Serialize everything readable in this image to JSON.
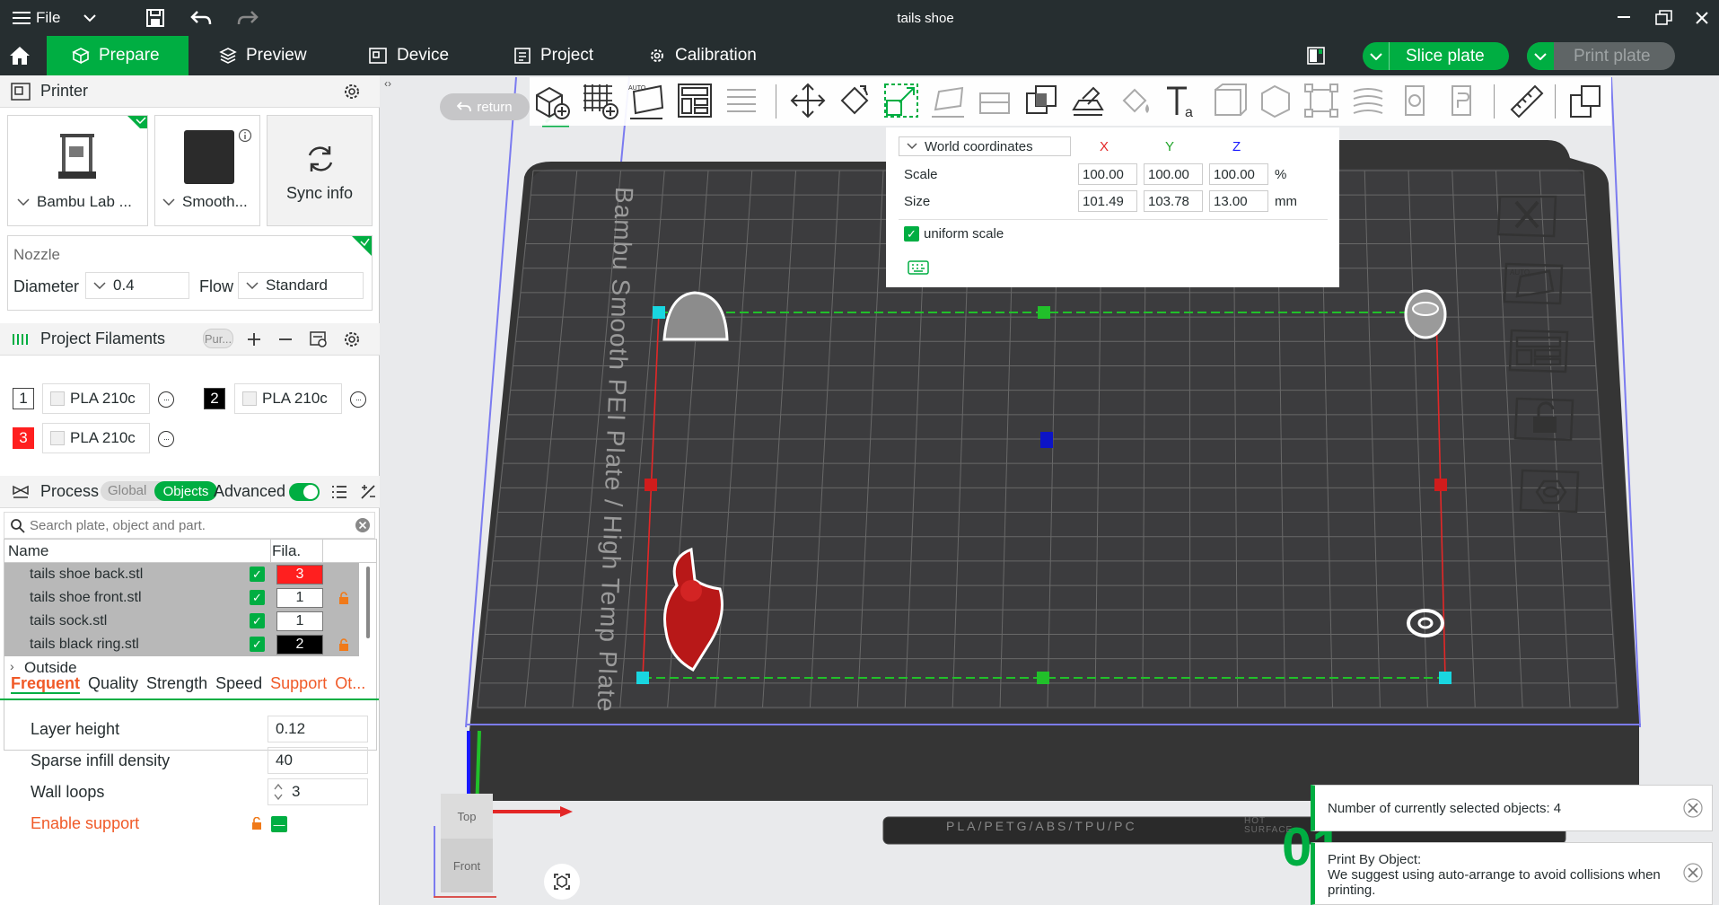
{
  "window": {
    "title": "tails shoe",
    "file_menu": "File"
  },
  "nav": {
    "tabs": [
      {
        "label": "Prepare"
      },
      {
        "label": "Preview"
      },
      {
        "label": "Device"
      },
      {
        "label": "Project"
      },
      {
        "label": "Calibration"
      }
    ],
    "slice_button": "Slice plate",
    "print_button": "Print plate"
  },
  "printer": {
    "header": "Printer",
    "printer_name": "Bambu Lab ...",
    "plate_name": "Smooth...",
    "sync_label": "Sync info",
    "nozzle_header": "Nozzle",
    "diameter_label": "Diameter",
    "diameter_value": "0.4",
    "flow_label": "Flow",
    "flow_value": "Standard"
  },
  "filaments": {
    "header": "Project Filaments",
    "purge_label": "Pur...",
    "items": [
      {
        "num": "1",
        "name": "PLA 210c",
        "color": "#ffffff"
      },
      {
        "num": "2",
        "name": "PLA 210c",
        "color": "#000000"
      },
      {
        "num": "3",
        "name": "PLA 210c",
        "color": "#ff1f1f"
      }
    ]
  },
  "process": {
    "header": "Process",
    "global_label": "Global",
    "objects_label": "Objects",
    "advanced_label": "Advanced",
    "search_placeholder": "Search plate, object and part.",
    "col_name": "Name",
    "col_fila": "Fila.",
    "objects": [
      {
        "name": "tails shoe back.stl",
        "fila": "3",
        "fila_bg": "#ff1f1f",
        "fila_fg": "#ffffff",
        "locked": false
      },
      {
        "name": "tails shoe front.stl",
        "fila": "1",
        "fila_bg": "#ffffff",
        "fila_fg": "#000000",
        "locked": true
      },
      {
        "name": "tails sock.stl",
        "fila": "1",
        "fila_bg": "#ffffff",
        "fila_fg": "#000000",
        "locked": false
      },
      {
        "name": "tails black ring.stl",
        "fila": "2",
        "fila_bg": "#000000",
        "fila_fg": "#ffffff",
        "locked": true
      }
    ],
    "outside_label": "Outside",
    "tabs": [
      "Frequent",
      "Quality",
      "Strength",
      "Speed",
      "Support",
      "Ot..."
    ],
    "layer_height_label": "Layer height",
    "layer_height_value": "0.12",
    "sparse_infill_label": "Sparse infill density",
    "sparse_infill_value": "40",
    "wall_loops_label": "Wall loops",
    "wall_loops_value": "3",
    "enable_support_label": "Enable support"
  },
  "viewport": {
    "return_label": "return",
    "plate_label": "Bambu Smooth PEI Plate / High Temp Plate",
    "bottom_label": "PLA/PETG/ABS/TPU/PC",
    "hot_label": "HOT SURFACE",
    "plate_number": "01",
    "cube_top": "Top",
    "cube_front": "Front"
  },
  "scale_popup": {
    "coords_label": "World coordinates",
    "x_label": "X",
    "y_label": "Y",
    "z_label": "Z",
    "scale_label": "Scale",
    "scale_x": "100.00",
    "scale_y": "100.00",
    "scale_z": "100.00",
    "scale_unit": "%",
    "size_label": "Size",
    "size_x": "101.49",
    "size_y": "103.78",
    "size_z": "13.00",
    "size_unit": "mm",
    "uniform_label": "uniform scale"
  },
  "toasts": {
    "selected_text": "Number of currently selected objects: 4",
    "print_by_object_title": "Print By Object:",
    "print_by_object_text": "We suggest using auto-arrange to avoid collisions when printing."
  },
  "colors": {
    "accent": "#00ae42",
    "dark": "#262e30",
    "support": "#f05a28",
    "plate": "#3e3e40"
  }
}
